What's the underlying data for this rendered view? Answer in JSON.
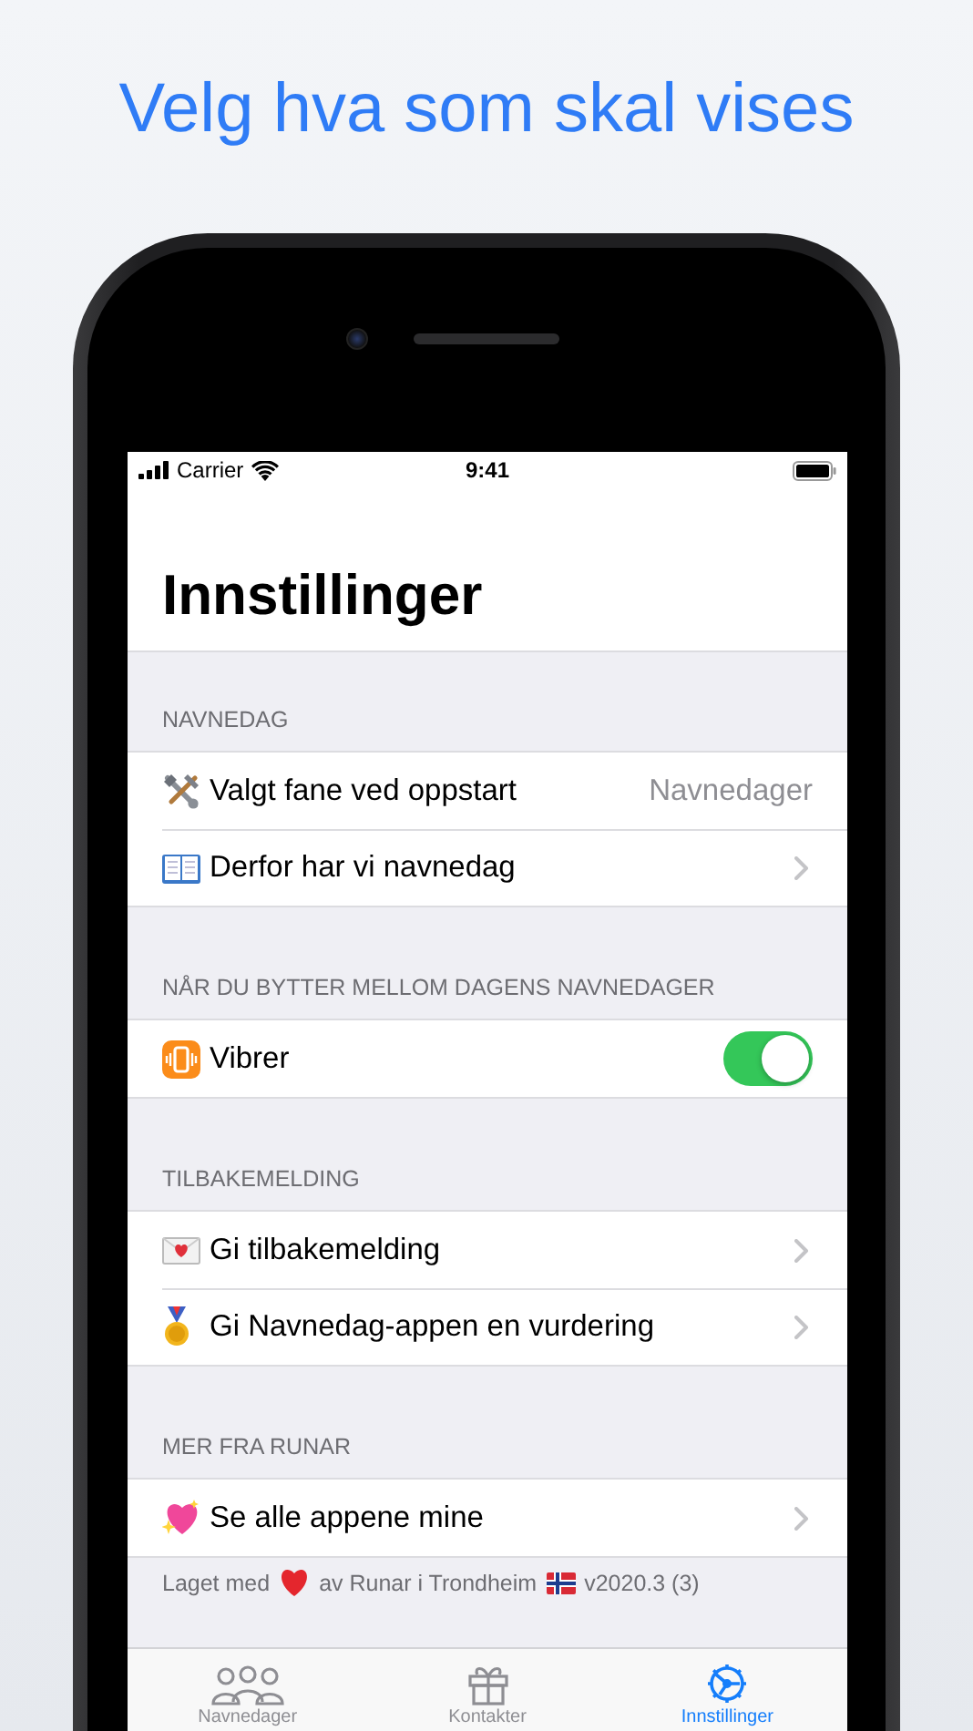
{
  "headline": "Velg hva som skal vises",
  "status_bar": {
    "carrier": "Carrier",
    "time": "9:41"
  },
  "title": "Innstillinger",
  "sections": [
    {
      "header": "NAVNEDAG",
      "rows": [
        {
          "kind": "value",
          "label": "Valgt fane ved oppstart",
          "value": "Navnedager"
        },
        {
          "kind": "link",
          "label": "Derfor har vi navnedag"
        }
      ]
    },
    {
      "header": "NÅR DU BYTTER MELLOM DAGENS NAVNEDAGER",
      "rows": [
        {
          "kind": "toggle",
          "label": "Vibrer",
          "on": true
        }
      ]
    },
    {
      "header": "TILBAKEMELDING",
      "rows": [
        {
          "kind": "link",
          "label": "Gi tilbakemelding"
        },
        {
          "kind": "link",
          "label": "Gi Navnedag-appen en vurdering"
        }
      ]
    },
    {
      "header": "MER FRA RUNAR",
      "rows": [
        {
          "kind": "link",
          "label": "Se alle appene mine"
        }
      ]
    }
  ],
  "footer": {
    "made_with": "Laget med",
    "by": "av Runar i Trondheim",
    "version": "v2020.3 (3)"
  },
  "tab_bar": [
    {
      "label": "Navnedager",
      "selected": false
    },
    {
      "label": "Kontakter",
      "selected": false
    },
    {
      "label": "Innstillinger",
      "selected": true
    }
  ]
}
